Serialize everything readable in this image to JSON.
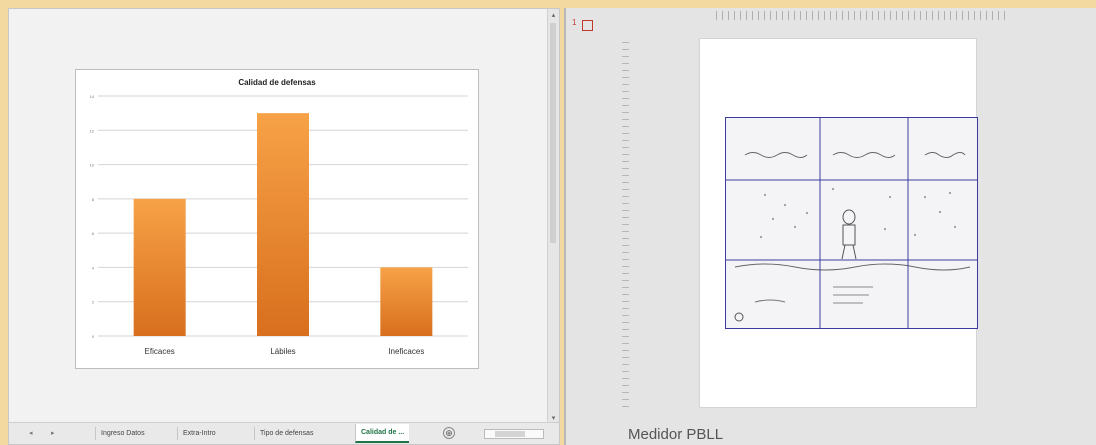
{
  "excel": {
    "sheet_tabs": [
      "Ingreso Datos",
      "Extra-Intro",
      "Tipo de defensas",
      "Calidad de ..."
    ],
    "active_tab": 3,
    "add_sheet": "⊕",
    "tab_nav_prev": "◂",
    "tab_nav_next": "▸"
  },
  "chart_data": {
    "type": "bar",
    "title": "Calidad de defensas",
    "categories": [
      "Eficaces",
      "Lábiles",
      "Ineficaces"
    ],
    "values": [
      8,
      13,
      4
    ],
    "ylim": [
      0,
      14
    ],
    "yticks": [
      0,
      2,
      4,
      6,
      8,
      10,
      12,
      14
    ],
    "grid": true,
    "bar_color_top": "#f7a247",
    "bar_color_bottom": "#d86f1e"
  },
  "ppt": {
    "slide_number": "1",
    "footer_title": "Medidor PBLL"
  }
}
